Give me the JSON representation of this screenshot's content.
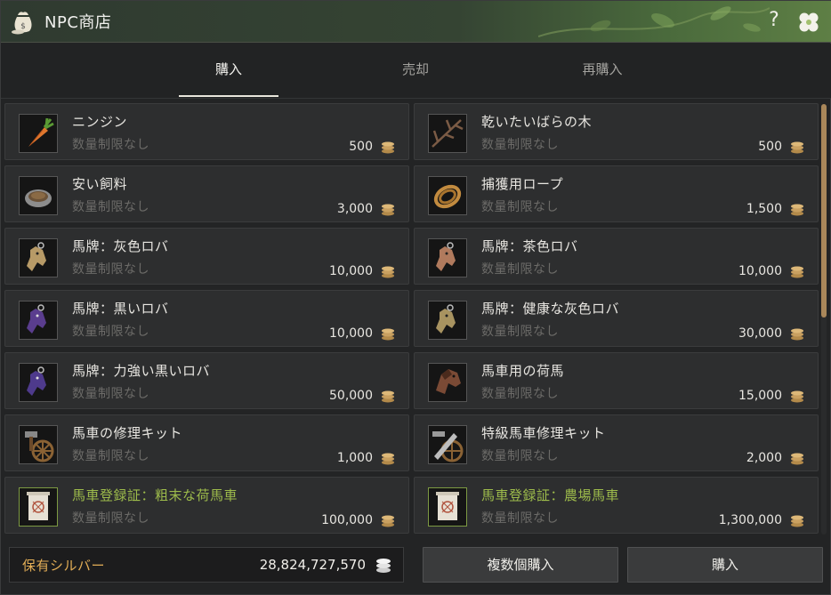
{
  "window": {
    "title": "NPC商店",
    "help": "?"
  },
  "tabs": [
    {
      "label": "購入",
      "active": true
    },
    {
      "label": "売却",
      "active": false
    },
    {
      "label": "再購入",
      "active": false
    }
  ],
  "items": [
    {
      "name": "ニンジン",
      "limit": "数量制限なし",
      "price": "500",
      "icon": "carrot-icon"
    },
    {
      "name": "乾いたいばらの木",
      "limit": "数量制限なし",
      "price": "500",
      "icon": "thorn-branch-icon"
    },
    {
      "name": "安い飼料",
      "limit": "数量制限なし",
      "price": "3,000",
      "icon": "feed-bowl-icon"
    },
    {
      "name": "捕獲用ロープ",
      "limit": "数量制限なし",
      "price": "1,500",
      "icon": "rope-icon"
    },
    {
      "name": "馬牌：灰色ロバ",
      "limit": "数量制限なし",
      "price": "10,000",
      "icon": "donkey-tag-icon"
    },
    {
      "name": "馬牌：茶色ロバ",
      "limit": "数量制限なし",
      "price": "10,000",
      "icon": "donkey-tag-icon"
    },
    {
      "name": "馬牌：黒いロバ",
      "limit": "数量制限なし",
      "price": "10,000",
      "icon": "donkey-tag-icon"
    },
    {
      "name": "馬牌：健康な灰色ロバ",
      "limit": "数量制限なし",
      "price": "30,000",
      "icon": "donkey-tag-icon"
    },
    {
      "name": "馬牌：力強い黒いロバ",
      "limit": "数量制限なし",
      "price": "50,000",
      "icon": "donkey-tag-icon"
    },
    {
      "name": "馬車用の荷馬",
      "limit": "数量制限なし",
      "price": "15,000",
      "icon": "horse-head-icon"
    },
    {
      "name": "馬車の修理キット",
      "limit": "数量制限なし",
      "price": "1,000",
      "icon": "repair-kit-icon"
    },
    {
      "name": "特級馬車修理キット",
      "limit": "数量制限なし",
      "price": "2,000",
      "icon": "premium-repair-kit-icon"
    },
    {
      "name": "馬車登録証：粗末な荷馬車",
      "limit": "数量制限なし",
      "price": "100,000",
      "icon": "wagon-certificate-icon"
    },
    {
      "name": "馬車登録証：農場馬車",
      "limit": "数量制限なし",
      "price": "1,300,000",
      "icon": "wagon-certificate-icon"
    }
  ],
  "footer": {
    "silver_label": "保有シルバー",
    "silver_value": "28,824,727,570",
    "bulk_buy_label": "複数個購入",
    "buy_label": "購入"
  },
  "colors": {
    "accent_gold": "#e2ad56",
    "certificate_green": "#9dbb4b",
    "scrollbar": "#a9875a"
  }
}
